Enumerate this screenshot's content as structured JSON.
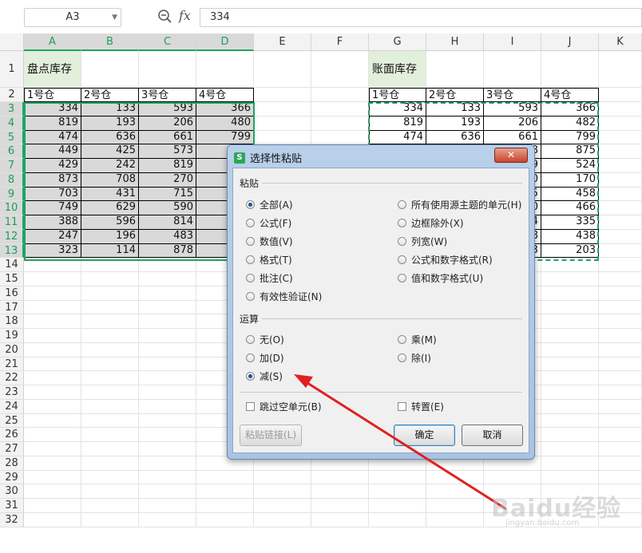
{
  "formula_bar": {
    "name_box": "A3",
    "fx_label": "fx",
    "value": "334"
  },
  "columns": [
    "A",
    "B",
    "C",
    "D",
    "E",
    "F",
    "G",
    "H",
    "I",
    "J",
    "K"
  ],
  "rows": [
    "1",
    "2",
    "3",
    "4",
    "5",
    "6",
    "7",
    "8",
    "9",
    "10",
    "11",
    "12",
    "13",
    "14",
    "15",
    "16",
    "17",
    "18",
    "19",
    "20",
    "21",
    "22",
    "23",
    "24",
    "25",
    "26",
    "27",
    "28",
    "29",
    "30",
    "31",
    "32"
  ],
  "sheet": {
    "left_title": "盘点库存",
    "right_title": "账面库存",
    "headers": [
      "1号仓",
      "2号仓",
      "3号仓",
      "4号仓"
    ],
    "left_values": [
      [
        "334",
        "133",
        "593",
        "366"
      ],
      [
        "819",
        "193",
        "206",
        "480"
      ],
      [
        "474",
        "636",
        "661",
        "799"
      ],
      [
        "449",
        "425",
        "573",
        ""
      ],
      [
        "429",
        "242",
        "819",
        ""
      ],
      [
        "873",
        "708",
        "270",
        ""
      ],
      [
        "703",
        "431",
        "715",
        ""
      ],
      [
        "749",
        "629",
        "590",
        ""
      ],
      [
        "388",
        "596",
        "814",
        ""
      ],
      [
        "247",
        "196",
        "483",
        ""
      ],
      [
        "323",
        "114",
        "878",
        ""
      ]
    ],
    "right_values": [
      [
        "334",
        "133",
        "593",
        "366"
      ],
      [
        "819",
        "193",
        "206",
        "482"
      ],
      [
        "474",
        "636",
        "661",
        "799"
      ],
      [
        "",
        "",
        "8",
        "875"
      ],
      [
        "",
        "",
        "9",
        "524"
      ],
      [
        "",
        "",
        "0",
        "170"
      ],
      [
        "",
        "",
        "5",
        "458"
      ],
      [
        "",
        "",
        "0",
        "466"
      ],
      [
        "",
        "",
        "4",
        "335"
      ],
      [
        "",
        "",
        "8",
        "438"
      ],
      [
        "",
        "",
        "3",
        "203"
      ]
    ]
  },
  "dialog": {
    "title": "选择性粘贴",
    "app_icon": "S",
    "close": "✕",
    "paste_section": "粘贴",
    "paste_options_left": [
      "全部(A)",
      "公式(F)",
      "数值(V)",
      "格式(T)",
      "批注(C)",
      "有效性验证(N)"
    ],
    "paste_options_right": [
      "所有使用源主题的单元(H)",
      "边框除外(X)",
      "列宽(W)",
      "公式和数字格式(R)",
      "值和数字格式(U)"
    ],
    "operation_section": "运算",
    "operation_left": [
      "无(O)",
      "加(D)",
      "减(S)"
    ],
    "operation_right": [
      "乘(M)",
      "除(I)"
    ],
    "skip_blanks": "跳过空单元(B)",
    "transpose": "转置(E)",
    "paste_link_button": "粘贴链接(L)",
    "ok_button": "确定",
    "cancel_button": "取消"
  },
  "colors": {
    "accent_green": "#1fa463",
    "title_fill": "#e2efda",
    "arrow_red": "#e02020"
  },
  "watermark": {
    "logo": "Baidu经验",
    "url": "jingyan.baidu.com"
  }
}
